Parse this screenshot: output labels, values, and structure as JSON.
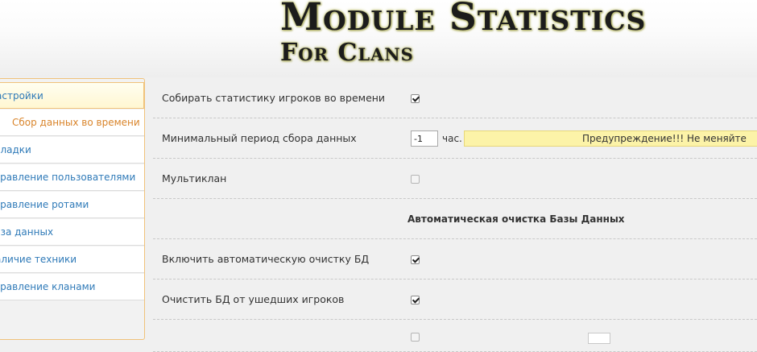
{
  "header": {
    "title_line1": "Module Statistics",
    "title_line2": "For Clans"
  },
  "sidebar": {
    "items": [
      {
        "label": "Настройки",
        "active": true
      },
      {
        "label": "Сбор данных во времени",
        "sub": true
      },
      {
        "label": "Вкладки"
      },
      {
        "label": "Управление пользователями"
      },
      {
        "label": "Управление ротами"
      },
      {
        "label": "База данных"
      },
      {
        "label": "Наличие техники"
      },
      {
        "label": "Управление кланами"
      }
    ]
  },
  "settings": {
    "collect_stats": {
      "label": "Собирать статистику игроков во времени",
      "checked": true
    },
    "min_period": {
      "label": "Минимальный период сбора данных",
      "value": "-1",
      "unit": "час.",
      "warning": "Предупреждение!!! Не меняйте"
    },
    "multiclan": {
      "label": "Мультиклан",
      "checked": false
    },
    "section_title": "Автоматическая очистка Базы Данных",
    "auto_cleanup": {
      "label": "Включить автоматическую очистку БД",
      "checked": true
    },
    "clean_departed": {
      "label": "Очистить БД от ушедших игроков",
      "checked": true
    }
  },
  "colors": {
    "link": "#2f7ab8",
    "active_sub": "#d9842a",
    "warning_bg": "#fcf3a8",
    "sidebar_border": "#f0c27a"
  }
}
